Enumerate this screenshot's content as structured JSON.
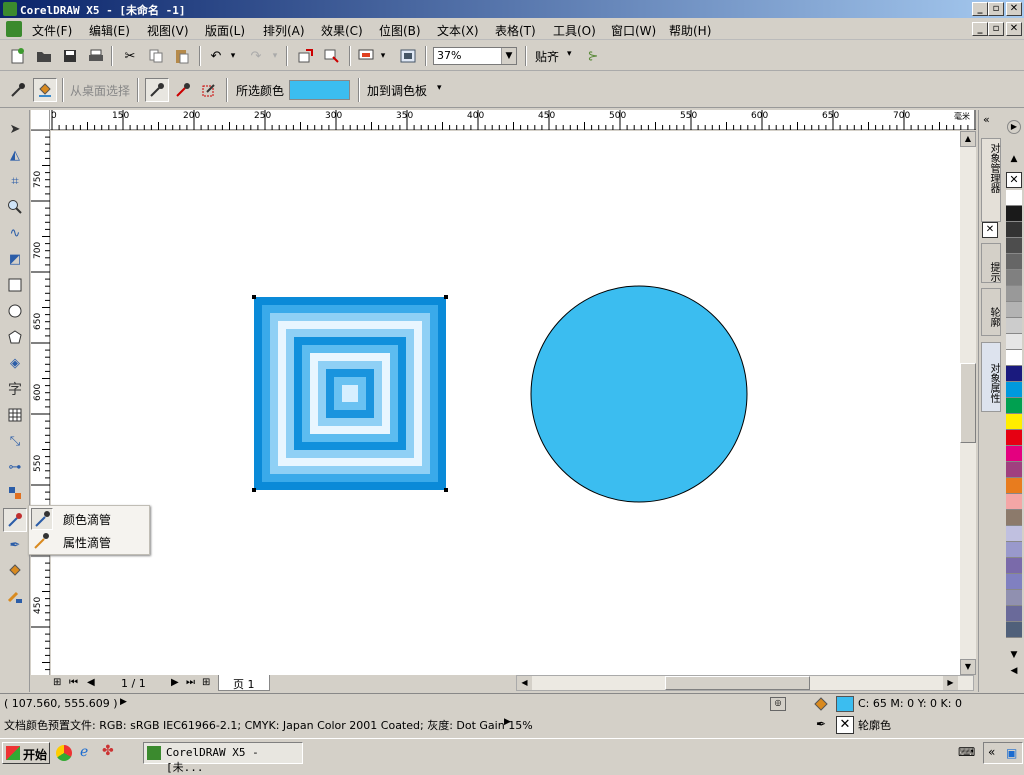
{
  "window": {
    "title": "CorelDRAW X5 - [未命名 -1]"
  },
  "menu": [
    "文件(F)",
    "编辑(E)",
    "视图(V)",
    "版面(L)",
    "排列(A)",
    "效果(C)",
    "位图(B)",
    "文本(X)",
    "表格(T)",
    "工具(O)",
    "窗口(W)",
    "帮助(H)"
  ],
  "toolbar": {
    "zoom": "37%",
    "snap_label": "贴齐"
  },
  "propbar": {
    "from_desktop": "从桌面选择",
    "selected_color_label": "所选颜色",
    "add_to_palette": "加到调色板",
    "selected_color": "#3bbdf0"
  },
  "ruler": {
    "h_labels": [
      "0",
      "150",
      "200",
      "250",
      "300",
      "350",
      "400",
      "450",
      "500",
      "550",
      "600",
      "650",
      "700"
    ],
    "h_unit": "毫米",
    "v_labels": [
      "750",
      "700",
      "650",
      "600",
      "550",
      "500",
      "450"
    ]
  },
  "flyout": {
    "items": [
      "颜色滴管",
      "属性滴管"
    ]
  },
  "page_nav": {
    "count": "1 / 1",
    "tab": "页 1"
  },
  "docker_tabs": [
    "对象管理器",
    "提示",
    "轮廓",
    "对象属性"
  ],
  "status": {
    "coords": "( 107.560, 555.609 )",
    "color_profile": "文档颜色预置文件: RGB: sRGB IEC61966-2.1; CMYK: Japan Color 2001 Coated; 灰度: Dot Gain 15%",
    "fill_values": "C: 65 M: 0 Y: 0 K: 0",
    "outline_label": "轮廓色"
  },
  "taskbar": {
    "start": "开始",
    "app": "CorelDRAW X5 - [未..."
  },
  "colors": {
    "circle_fill": "#3bbdf0",
    "title_start": "#0a246a",
    "title_end": "#a6caf0",
    "palette": [
      "#ffffff",
      "#1a1a1a",
      "#333333",
      "#4d4d4d",
      "#666666",
      "#808080",
      "#999999",
      "#b3b3b3",
      "#cccccc",
      "#e6e6e6",
      "#ffffff",
      "#1a1a7e",
      "#0099dd",
      "#00a050",
      "#ffee00",
      "#e60012",
      "#e4007f",
      "#a0407f",
      "#e87c1e",
      "#f4a6a6",
      "#8c7a6b",
      "#c0c0e0",
      "#9999cc",
      "#7a6aaa",
      "#8080c0",
      "#9090b0",
      "#6a6a9a",
      "#50607a"
    ]
  }
}
